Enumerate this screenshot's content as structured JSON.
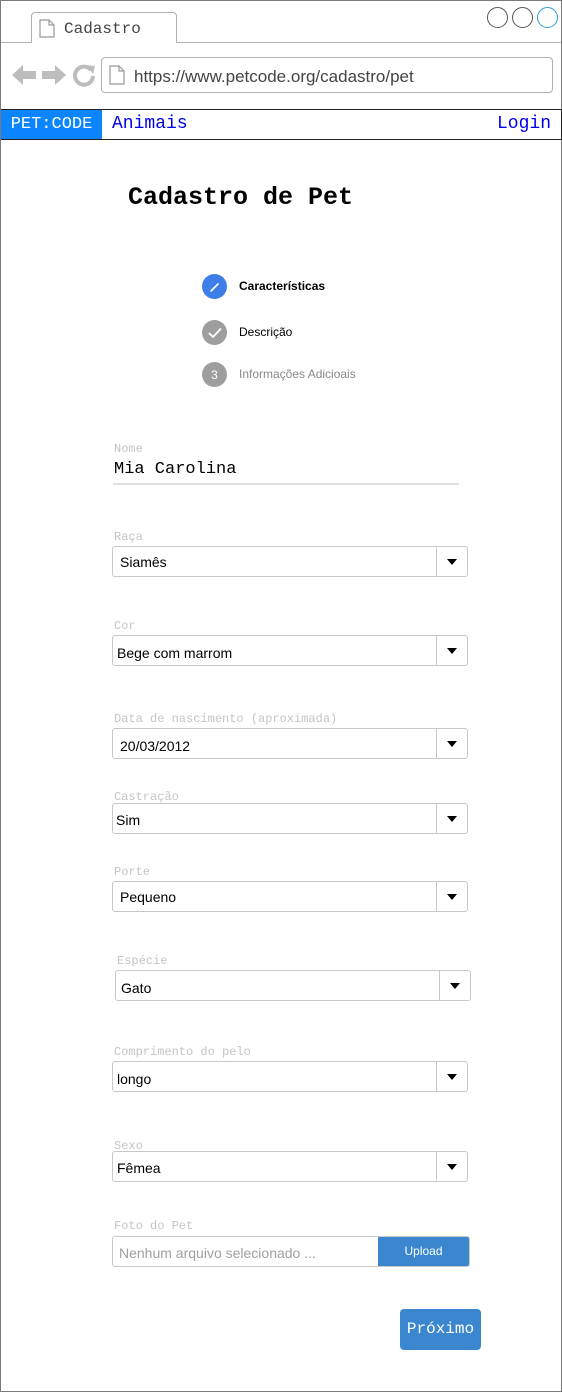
{
  "browser": {
    "tab_title": "Cadastro",
    "url": "https://www.petcode.org/cadastro/pet"
  },
  "nav": {
    "brand": "PET:CODE",
    "animais": "Animais",
    "login": "Login"
  },
  "page": {
    "title": "Cadastro de Pet"
  },
  "stepper": {
    "steps": [
      {
        "label": "Características",
        "state": "active",
        "icon": "pencil-icon"
      },
      {
        "label": "Descrição",
        "state": "done",
        "icon": "check-icon"
      },
      {
        "label": "Informações Adicioais",
        "state": "pending",
        "number": "3"
      }
    ]
  },
  "form": {
    "nome": {
      "label": "Nome",
      "value": "Mia Carolina"
    },
    "raca": {
      "label": "Raça",
      "value": "Siamês"
    },
    "cor": {
      "label": "Cor",
      "value": "Bege com marrom"
    },
    "nascimento": {
      "label": "Data de nascimento (aproximada)",
      "value": "20/03/2012"
    },
    "castracao": {
      "label": "Castração",
      "value": "Sim"
    },
    "porte": {
      "label": "Porte",
      "value": "Pequeno"
    },
    "especie": {
      "label": "Espécie",
      "value": "Gato"
    },
    "pelo": {
      "label": "Comprimento do pelo",
      "value": "longo"
    },
    "sexo": {
      "label": "Sexo",
      "value": "Fêmea"
    },
    "foto": {
      "label": "Foto do Pet",
      "placeholder": "Nenhum arquivo selecionado ...",
      "button": "Upload"
    }
  },
  "actions": {
    "next": "Próximo"
  },
  "colors": {
    "brand": "#0a84ff",
    "primary_button": "#3a87cf",
    "step_active": "#3d7ee8",
    "step_inactive": "#9e9e9e"
  }
}
